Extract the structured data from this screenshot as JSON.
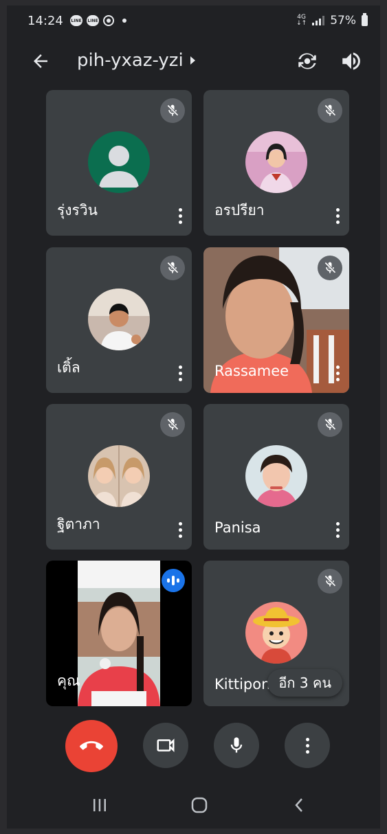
{
  "status_bar": {
    "time": "14:24",
    "network_top": "4G",
    "network_bottom": "↓↑",
    "battery_percent": "57%"
  },
  "header": {
    "meeting_code": "pih-yxaz-yzi"
  },
  "participants": [
    {
      "name": "รุ่งรวิน",
      "muted": true
    },
    {
      "name": "อรปรียา",
      "muted": true
    },
    {
      "name": "เติ้ล",
      "muted": true
    },
    {
      "name": "Rassamee",
      "muted": true
    },
    {
      "name": "ฐิตาภา",
      "muted": true
    },
    {
      "name": "Panisa",
      "muted": true
    },
    {
      "name": "คุณ",
      "muted": false,
      "speaking": true
    },
    {
      "name": "Kittipong",
      "muted": true
    }
  ],
  "others_badge": "อีก 3 คน",
  "colors": {
    "background": "#202124",
    "tile": "#3c4043",
    "end_call": "#ea4335",
    "speaking": "#1a73e8"
  }
}
